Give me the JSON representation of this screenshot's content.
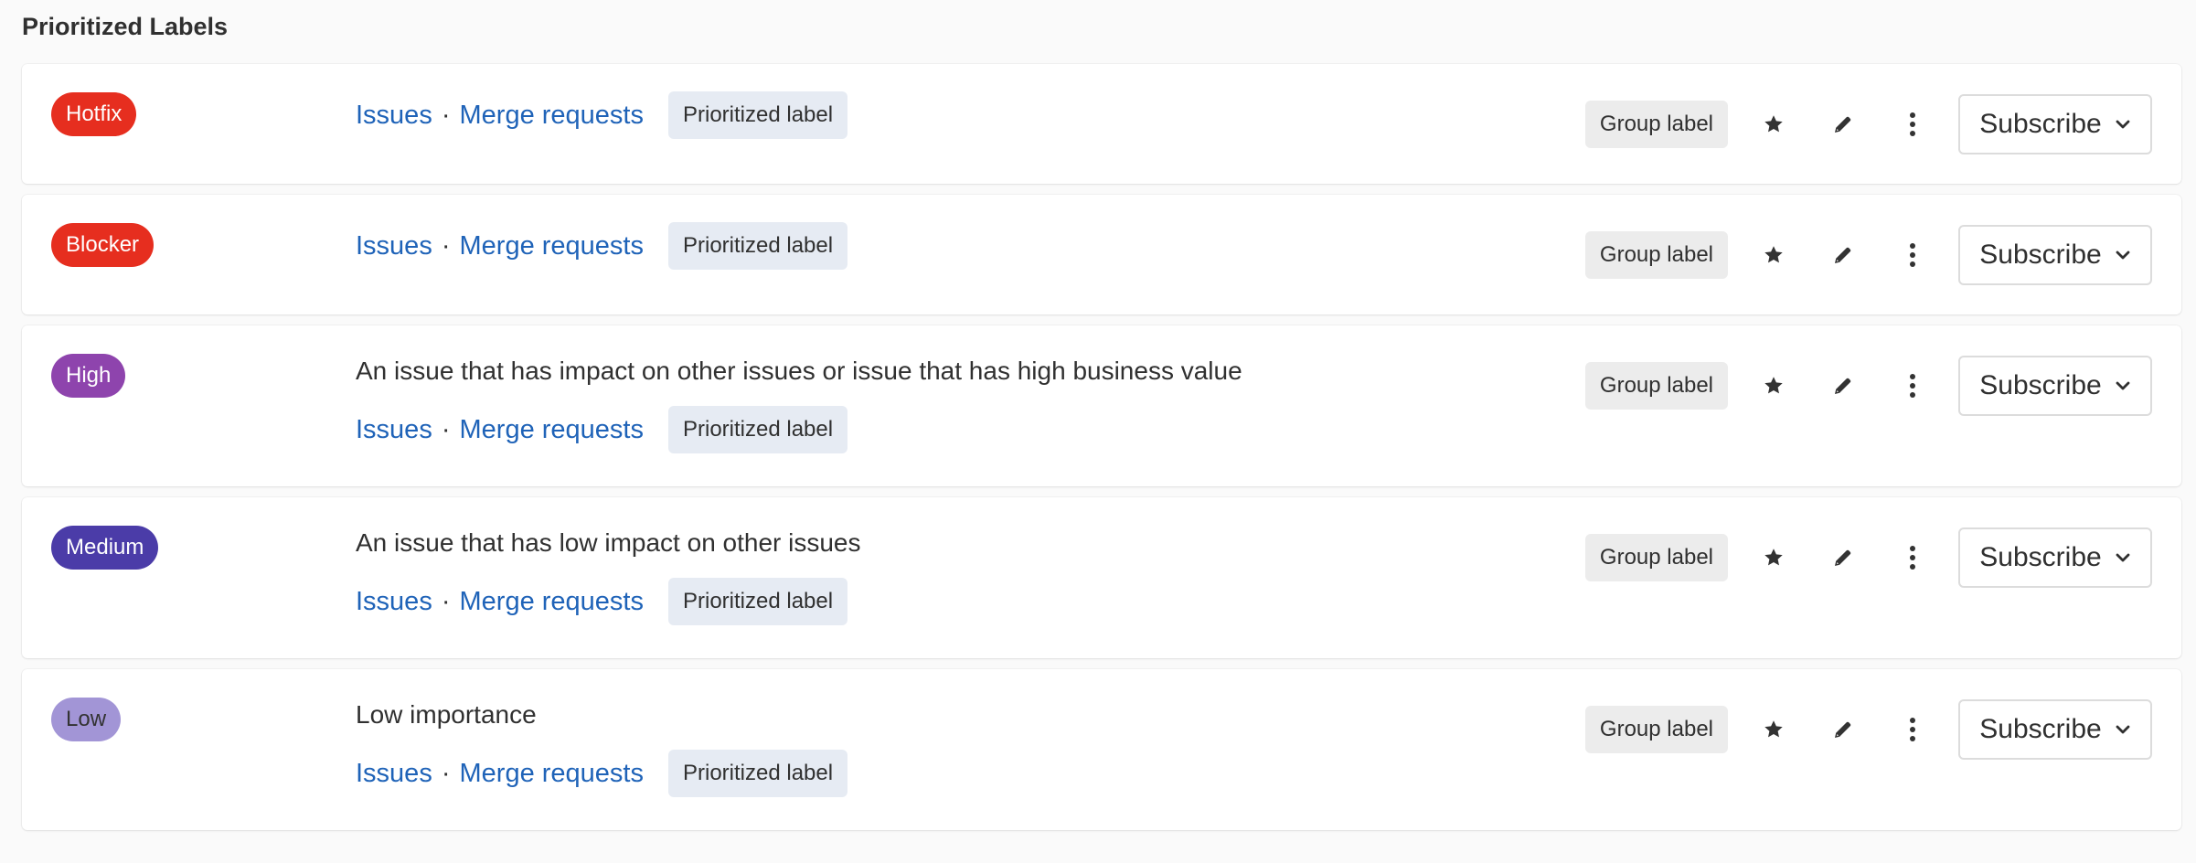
{
  "section": {
    "title": "Prioritized Labels"
  },
  "labels": [
    {
      "name": "Hotfix",
      "color": "#e62e1f",
      "text_color": "#ffffff",
      "description": "",
      "issues_link": "Issues",
      "separator": "·",
      "mr_link": "Merge requests",
      "prioritized_badge": "Prioritized label",
      "group_badge": "Group label",
      "subscribe_label": "Subscribe"
    },
    {
      "name": "Blocker",
      "color": "#e62e1f",
      "text_color": "#ffffff",
      "description": "",
      "issues_link": "Issues",
      "separator": "·",
      "mr_link": "Merge requests",
      "prioritized_badge": "Prioritized label",
      "group_badge": "Group label",
      "subscribe_label": "Subscribe"
    },
    {
      "name": "High",
      "color": "#8e44ad",
      "text_color": "#ffffff",
      "description": "An issue that has impact on other issues or issue that has high business value",
      "issues_link": "Issues",
      "separator": "·",
      "mr_link": "Merge requests",
      "prioritized_badge": "Prioritized label",
      "group_badge": "Group label",
      "subscribe_label": "Subscribe"
    },
    {
      "name": "Medium",
      "color": "#4b3ca8",
      "text_color": "#ffffff",
      "description": "An issue that has low impact on other issues",
      "issues_link": "Issues",
      "separator": "·",
      "mr_link": "Merge requests",
      "prioritized_badge": "Prioritized label",
      "group_badge": "Group label",
      "subscribe_label": "Subscribe"
    },
    {
      "name": "Low",
      "color": "#a295d6",
      "text_color": "#333333",
      "description": "Low importance",
      "issues_link": "Issues",
      "separator": "·",
      "mr_link": "Merge requests",
      "prioritized_badge": "Prioritized label",
      "group_badge": "Group label",
      "subscribe_label": "Subscribe"
    }
  ],
  "icons": {
    "prioritize": "star-icon",
    "edit": "pencil-icon",
    "more": "more-vertical-icon",
    "dropdown": "chevron-down-icon"
  }
}
